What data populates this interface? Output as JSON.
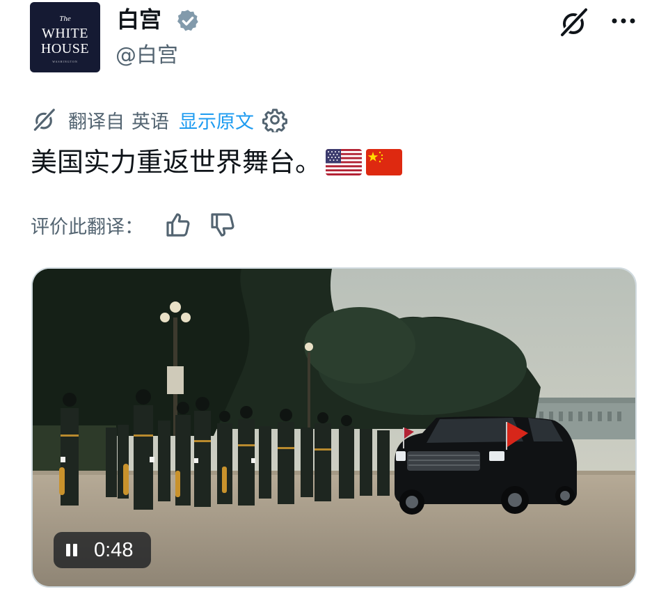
{
  "account": {
    "avatar_lines": [
      "The",
      "WHITE",
      "HOUSE",
      "WASHINGTON"
    ],
    "name": "白宫",
    "handle": "@白宫",
    "verified_icon": "verified-badge-icon"
  },
  "header_actions": {
    "grok_icon": "grok-icon",
    "more_icon": "more-icon"
  },
  "translation": {
    "translated_from": "翻译自",
    "language": "英语",
    "show_original": "显示原文",
    "settings_icon": "gear-icon"
  },
  "tweet": {
    "text": "美国实力重返世界舞台。",
    "emojis": [
      "us-flag",
      "china-flag"
    ]
  },
  "rating": {
    "label": "评价此翻译：",
    "thumbs_up_icon": "thumbs-up-icon",
    "thumbs_down_icon": "thumbs-down-icon"
  },
  "media": {
    "type": "video",
    "duration": "0:48",
    "state": "playing"
  },
  "colors": {
    "link": "#1d9bf0",
    "muted": "#536471",
    "avatar_bg": "#151a33",
    "verified": "#829aab"
  }
}
